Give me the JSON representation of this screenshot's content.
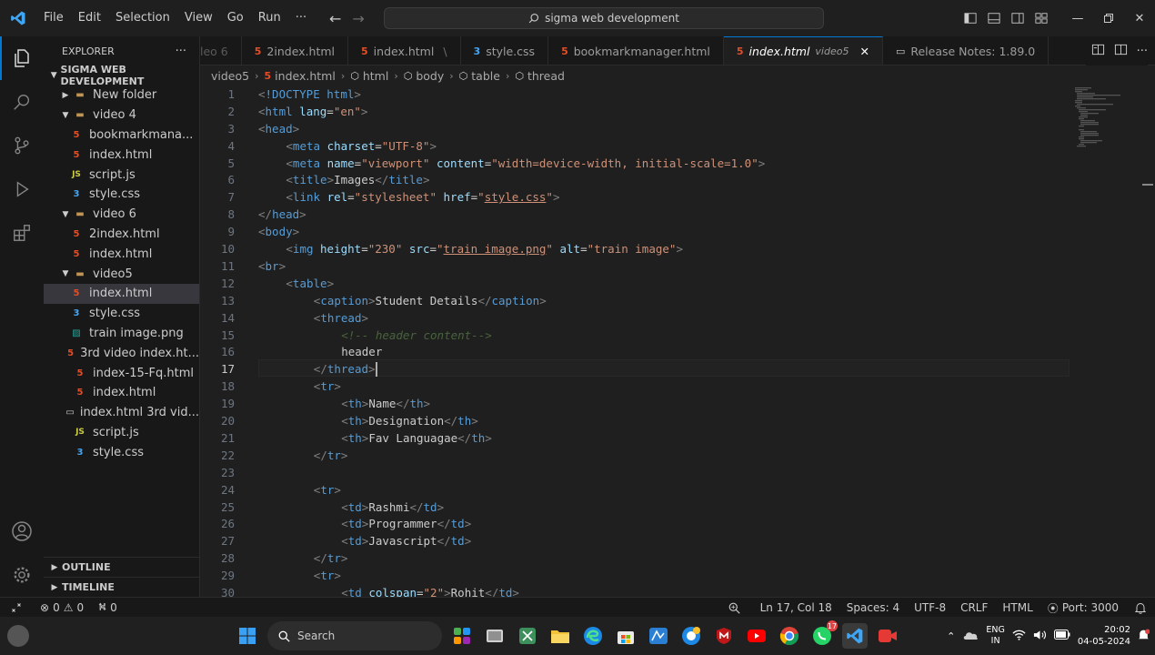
{
  "titlebar": {
    "menu": [
      "File",
      "Edit",
      "Selection",
      "View",
      "Go",
      "Run"
    ],
    "more": "···",
    "command_center": "sigma web development"
  },
  "sidebar": {
    "title": "EXPLORER",
    "more": "···",
    "root": "SIGMA WEB DEVELOPMENT",
    "items": [
      {
        "label": "New folder",
        "type": "folder",
        "level": 1,
        "expanded": false
      },
      {
        "label": "video 4",
        "type": "folder",
        "level": 1,
        "expanded": true
      },
      {
        "label": "bookmarkmana...",
        "type": "html",
        "level": 2
      },
      {
        "label": "index.html",
        "type": "html",
        "level": 2
      },
      {
        "label": "script.js",
        "type": "js",
        "level": 2
      },
      {
        "label": "style.css",
        "type": "css",
        "level": 2
      },
      {
        "label": "video 6",
        "type": "folder",
        "level": 1,
        "expanded": true
      },
      {
        "label": "2index.html",
        "type": "html",
        "level": 2
      },
      {
        "label": "index.html",
        "type": "html",
        "level": 2
      },
      {
        "label": "video5",
        "type": "folder",
        "level": 1,
        "expanded": true
      },
      {
        "label": "index.html",
        "type": "html",
        "level": 2,
        "selected": true
      },
      {
        "label": "style.css",
        "type": "css",
        "level": 2
      },
      {
        "label": "train image.png",
        "type": "img",
        "level": 2
      },
      {
        "label": "3rd video index.ht...",
        "type": "html",
        "level": 1
      },
      {
        "label": "index-15-Fq.html",
        "type": "html",
        "level": 1,
        "error": true
      },
      {
        "label": "index.html",
        "type": "html",
        "level": 1
      },
      {
        "label": "index.html 3rd vid...",
        "type": "file",
        "level": 1
      },
      {
        "label": "script.js",
        "type": "js",
        "level": 1
      },
      {
        "label": "style.css",
        "type": "css",
        "level": 1
      }
    ],
    "outline": "OUTLINE",
    "timeline": "TIMELINE"
  },
  "tabs": [
    {
      "label": "leo 6",
      "type": "none",
      "faded": true
    },
    {
      "label": "2index.html",
      "type": "html"
    },
    {
      "label": "index.html",
      "type": "html",
      "suffix": "\\"
    },
    {
      "label": "style.css",
      "type": "css"
    },
    {
      "label": "bookmarkmanager.html",
      "type": "html"
    },
    {
      "label": "index.html",
      "type": "html",
      "active": true,
      "desc": "video5"
    },
    {
      "label": "Release Notes: 1.89.0",
      "type": "file"
    }
  ],
  "breadcrumb": [
    "video5",
    "index.html",
    "html",
    "body",
    "table",
    "thread"
  ],
  "editor": {
    "current_line": 17,
    "lines": [
      {
        "n": 1,
        "indent": 0,
        "tokens": [
          [
            "br",
            "<"
          ],
          [
            "doc",
            "!DOCTYPE html"
          ],
          [
            "br",
            ">"
          ]
        ]
      },
      {
        "n": 2,
        "indent": 0,
        "tokens": [
          [
            "br",
            "<"
          ],
          [
            "tag",
            "html"
          ],
          [
            "txt",
            " "
          ],
          [
            "attr",
            "lang"
          ],
          [
            "txt",
            "="
          ],
          [
            "str",
            "\"en\""
          ],
          [
            "br",
            ">"
          ]
        ]
      },
      {
        "n": 3,
        "indent": 0,
        "tokens": [
          [
            "br",
            "<"
          ],
          [
            "tag",
            "head"
          ],
          [
            "br",
            ">"
          ]
        ]
      },
      {
        "n": 4,
        "indent": 1,
        "tokens": [
          [
            "br",
            "<"
          ],
          [
            "tag",
            "meta"
          ],
          [
            "txt",
            " "
          ],
          [
            "attr",
            "charset"
          ],
          [
            "txt",
            "="
          ],
          [
            "str",
            "\"UTF-8\""
          ],
          [
            "br",
            ">"
          ]
        ]
      },
      {
        "n": 5,
        "indent": 1,
        "tokens": [
          [
            "br",
            "<"
          ],
          [
            "tag",
            "meta"
          ],
          [
            "txt",
            " "
          ],
          [
            "attr",
            "name"
          ],
          [
            "txt",
            "="
          ],
          [
            "str",
            "\"viewport\""
          ],
          [
            "txt",
            " "
          ],
          [
            "attr",
            "content"
          ],
          [
            "txt",
            "="
          ],
          [
            "str",
            "\"width=device-width, initial-scale=1.0\""
          ],
          [
            "br",
            ">"
          ]
        ]
      },
      {
        "n": 6,
        "indent": 1,
        "tokens": [
          [
            "br",
            "<"
          ],
          [
            "tag",
            "title"
          ],
          [
            "br",
            ">"
          ],
          [
            "txt",
            "Images"
          ],
          [
            "br",
            "</"
          ],
          [
            "tag",
            "title"
          ],
          [
            "br",
            ">"
          ]
        ]
      },
      {
        "n": 7,
        "indent": 1,
        "tokens": [
          [
            "br",
            "<"
          ],
          [
            "tag",
            "link"
          ],
          [
            "txt",
            " "
          ],
          [
            "attr",
            "rel"
          ],
          [
            "txt",
            "="
          ],
          [
            "str",
            "\"stylesheet\""
          ],
          [
            "txt",
            " "
          ],
          [
            "attr",
            "href"
          ],
          [
            "txt",
            "="
          ],
          [
            "str",
            "\""
          ],
          [
            "strlink",
            "style.css"
          ],
          [
            "str",
            "\""
          ],
          [
            "br",
            ">"
          ]
        ]
      },
      {
        "n": 8,
        "indent": 0,
        "tokens": [
          [
            "br",
            "</"
          ],
          [
            "tag",
            "head"
          ],
          [
            "br",
            ">"
          ]
        ]
      },
      {
        "n": 9,
        "indent": 0,
        "tokens": [
          [
            "br",
            "<"
          ],
          [
            "tag",
            "body"
          ],
          [
            "br",
            ">"
          ]
        ]
      },
      {
        "n": 10,
        "indent": 1,
        "tokens": [
          [
            "br",
            "<"
          ],
          [
            "tag",
            "img"
          ],
          [
            "txt",
            " "
          ],
          [
            "attr",
            "height"
          ],
          [
            "txt",
            "="
          ],
          [
            "str",
            "\"230\""
          ],
          [
            "txt",
            " "
          ],
          [
            "attr",
            "src"
          ],
          [
            "txt",
            "="
          ],
          [
            "str",
            "\""
          ],
          [
            "strlink",
            "train image.png"
          ],
          [
            "str",
            "\""
          ],
          [
            "txt",
            " "
          ],
          [
            "attr",
            "alt"
          ],
          [
            "txt",
            "="
          ],
          [
            "str",
            "\"train image\""
          ],
          [
            "br",
            ">"
          ]
        ]
      },
      {
        "n": 11,
        "indent": 0,
        "tokens": [
          [
            "br",
            "<"
          ],
          [
            "tag",
            "br"
          ],
          [
            "br",
            ">"
          ]
        ]
      },
      {
        "n": 12,
        "indent": 1,
        "tokens": [
          [
            "br",
            "<"
          ],
          [
            "tag",
            "table"
          ],
          [
            "br",
            ">"
          ]
        ]
      },
      {
        "n": 13,
        "indent": 2,
        "tokens": [
          [
            "br",
            "<"
          ],
          [
            "tag",
            "caption"
          ],
          [
            "br",
            ">"
          ],
          [
            "txt",
            "Student Details"
          ],
          [
            "br",
            "</"
          ],
          [
            "tag",
            "caption"
          ],
          [
            "br",
            ">"
          ]
        ]
      },
      {
        "n": 14,
        "indent": 2,
        "tokens": [
          [
            "br",
            "<"
          ],
          [
            "tag",
            "thread"
          ],
          [
            "br",
            ">"
          ]
        ]
      },
      {
        "n": 15,
        "indent": 3,
        "tokens": [
          [
            "cmt",
            "<!-- header content-->"
          ]
        ]
      },
      {
        "n": 16,
        "indent": 3,
        "tokens": [
          [
            "txt",
            "header"
          ]
        ]
      },
      {
        "n": 17,
        "indent": 2,
        "tokens": [
          [
            "br",
            "</"
          ],
          [
            "tag",
            "thread"
          ],
          [
            "br",
            ">"
          ]
        ],
        "caret": true
      },
      {
        "n": 18,
        "indent": 2,
        "tokens": [
          [
            "br",
            "<"
          ],
          [
            "tag",
            "tr"
          ],
          [
            "br",
            ">"
          ]
        ]
      },
      {
        "n": 19,
        "indent": 3,
        "tokens": [
          [
            "br",
            "<"
          ],
          [
            "tag",
            "th"
          ],
          [
            "br",
            ">"
          ],
          [
            "txt",
            "Name"
          ],
          [
            "br",
            "</"
          ],
          [
            "tag",
            "th"
          ],
          [
            "br",
            ">"
          ]
        ]
      },
      {
        "n": 20,
        "indent": 3,
        "tokens": [
          [
            "br",
            "<"
          ],
          [
            "tag",
            "th"
          ],
          [
            "br",
            ">"
          ],
          [
            "txt",
            "Designation"
          ],
          [
            "br",
            "</"
          ],
          [
            "tag",
            "th"
          ],
          [
            "br",
            ">"
          ]
        ]
      },
      {
        "n": 21,
        "indent": 3,
        "tokens": [
          [
            "br",
            "<"
          ],
          [
            "tag",
            "th"
          ],
          [
            "br",
            ">"
          ],
          [
            "txt",
            "Fav Languagae"
          ],
          [
            "br",
            "</"
          ],
          [
            "tag",
            "th"
          ],
          [
            "br",
            ">"
          ]
        ]
      },
      {
        "n": 22,
        "indent": 2,
        "tokens": [
          [
            "br",
            "</"
          ],
          [
            "tag",
            "tr"
          ],
          [
            "br",
            ">"
          ]
        ]
      },
      {
        "n": 23,
        "indent": 0,
        "tokens": []
      },
      {
        "n": 24,
        "indent": 2,
        "tokens": [
          [
            "br",
            "<"
          ],
          [
            "tag",
            "tr"
          ],
          [
            "br",
            ">"
          ]
        ]
      },
      {
        "n": 25,
        "indent": 3,
        "tokens": [
          [
            "br",
            "<"
          ],
          [
            "tag",
            "td"
          ],
          [
            "br",
            ">"
          ],
          [
            "txt",
            "Rashmi"
          ],
          [
            "br",
            "</"
          ],
          [
            "tag",
            "td"
          ],
          [
            "br",
            ">"
          ]
        ]
      },
      {
        "n": 26,
        "indent": 3,
        "tokens": [
          [
            "br",
            "<"
          ],
          [
            "tag",
            "td"
          ],
          [
            "br",
            ">"
          ],
          [
            "txt",
            "Programmer"
          ],
          [
            "br",
            "</"
          ],
          [
            "tag",
            "td"
          ],
          [
            "br",
            ">"
          ]
        ]
      },
      {
        "n": 27,
        "indent": 3,
        "tokens": [
          [
            "br",
            "<"
          ],
          [
            "tag",
            "td"
          ],
          [
            "br",
            ">"
          ],
          [
            "txt",
            "Javascript"
          ],
          [
            "br",
            "</"
          ],
          [
            "tag",
            "td"
          ],
          [
            "br",
            ">"
          ]
        ]
      },
      {
        "n": 28,
        "indent": 2,
        "tokens": [
          [
            "br",
            "</"
          ],
          [
            "tag",
            "tr"
          ],
          [
            "br",
            ">"
          ]
        ]
      },
      {
        "n": 29,
        "indent": 2,
        "tokens": [
          [
            "br",
            "<"
          ],
          [
            "tag",
            "tr"
          ],
          [
            "br",
            ">"
          ]
        ]
      },
      {
        "n": 30,
        "indent": 3,
        "tokens": [
          [
            "br",
            "<"
          ],
          [
            "tag",
            "td"
          ],
          [
            "txt",
            " "
          ],
          [
            "attr",
            "colspan"
          ],
          [
            "txt",
            "="
          ],
          [
            "str",
            "\"2\""
          ],
          [
            "br",
            ">"
          ],
          [
            "txt",
            "Rohit"
          ],
          [
            "br",
            "</"
          ],
          [
            "tag",
            "td"
          ],
          [
            "br",
            ">"
          ]
        ]
      }
    ]
  },
  "statusbar": {
    "errors": "0",
    "warnings": "0",
    "ports": "0",
    "position": "Ln 17, Col 18",
    "spaces": "Spaces: 4",
    "encoding": "UTF-8",
    "eol": "CRLF",
    "language": "HTML",
    "port": "Port: 3000"
  },
  "taskbar": {
    "search": "Search",
    "whatsapp_badge": "17",
    "lang_top": "ENG",
    "lang_bottom": "IN",
    "time": "20:02",
    "date": "04-05-2024"
  },
  "colors": {
    "accent": "#0078d4",
    "html_icon": "#e44d26",
    "css_icon": "#42a5f5",
    "js_icon": "#cbcb41",
    "error": "#c72e0f"
  }
}
